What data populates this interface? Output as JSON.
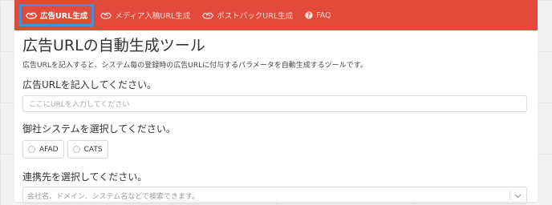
{
  "nav": {
    "items": [
      {
        "label": "広告URL生成",
        "icon": "handshake-icon",
        "active": true
      },
      {
        "label": "メディア入稿URL生成",
        "icon": "handshake-icon",
        "active": false
      },
      {
        "label": "ポストバックURL生成",
        "icon": "handshake-icon",
        "active": false
      },
      {
        "label": "FAQ",
        "icon": "question-circle-icon",
        "active": false
      }
    ],
    "background": "#e24b3b",
    "active_outline": "#4a90d9"
  },
  "page": {
    "title": "広告URLの自動生成ツール",
    "description": "広告URLを記入すると、システム毎の登録時の広告URLに付与するパラメータを自動生成するツールです。"
  },
  "url_section": {
    "label": "広告URLを記入してください。",
    "placeholder": "ここにURLを入力してください"
  },
  "system_section": {
    "label": "御社システムを選択してください。",
    "options": [
      "AFAD",
      "CATS"
    ]
  },
  "partner_section": {
    "label": "連携先を選択してください。",
    "placeholder": "会社名、ドメイン、システム名などで検索できます。"
  }
}
